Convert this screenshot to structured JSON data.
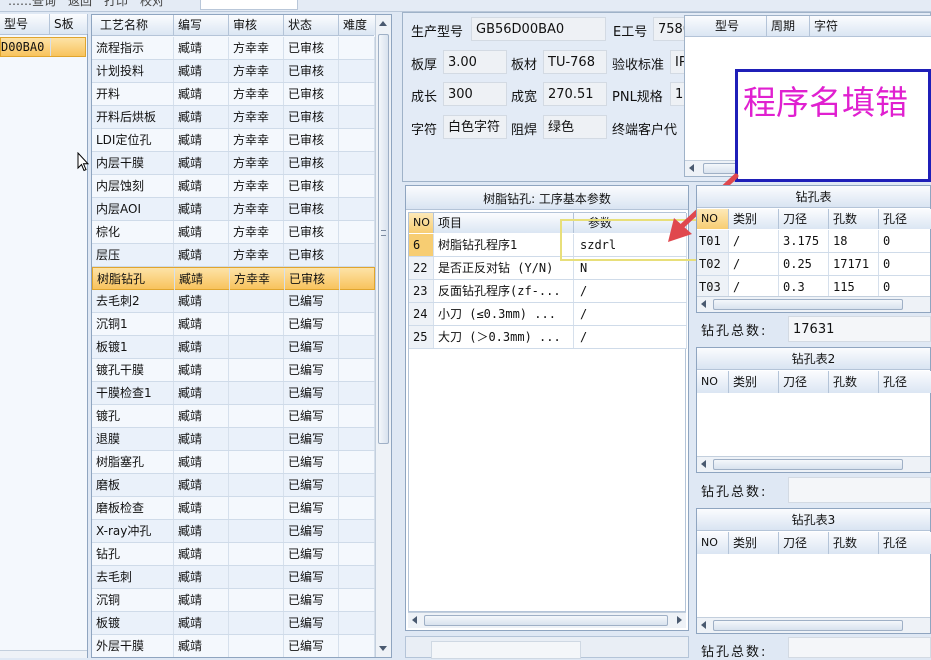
{
  "top_strip": {
    "text": "……查询　返回　打印　校对"
  },
  "left_grid": {
    "columns": [
      "型号",
      "S板"
    ],
    "rows": [
      {
        "model": "D00BA0",
        "s": ""
      }
    ]
  },
  "process_grid": {
    "columns": [
      "工艺名称",
      "编写",
      "审核",
      "状态",
      "难度"
    ],
    "rows": [
      {
        "name": "流程指示",
        "writer": "臧靖",
        "reviewer": "方幸幸",
        "status": "已审核"
      },
      {
        "name": "计划投料",
        "writer": "臧靖",
        "reviewer": "方幸幸",
        "status": "已审核"
      },
      {
        "name": "开料",
        "writer": "臧靖",
        "reviewer": "方幸幸",
        "status": "已审核"
      },
      {
        "name": "开料后烘板",
        "writer": "臧靖",
        "reviewer": "方幸幸",
        "status": "已审核"
      },
      {
        "name": "LDI定位孔",
        "writer": "臧靖",
        "reviewer": "方幸幸",
        "status": "已审核"
      },
      {
        "name": "内层干膜",
        "writer": "臧靖",
        "reviewer": "方幸幸",
        "status": "已审核"
      },
      {
        "name": "内层蚀刻",
        "writer": "臧靖",
        "reviewer": "方幸幸",
        "status": "已审核"
      },
      {
        "name": "内层AOI",
        "writer": "臧靖",
        "reviewer": "方幸幸",
        "status": "已审核"
      },
      {
        "name": "棕化",
        "writer": "臧靖",
        "reviewer": "方幸幸",
        "status": "已审核"
      },
      {
        "name": "层压",
        "writer": "臧靖",
        "reviewer": "方幸幸",
        "status": "已审核"
      },
      {
        "name": "树脂钻孔",
        "writer": "臧靖",
        "reviewer": "方幸幸",
        "status": "已审核",
        "selected": true
      },
      {
        "name": "去毛刺2",
        "writer": "臧靖",
        "reviewer": "",
        "status": "已编写"
      },
      {
        "name": "沉铜1",
        "writer": "臧靖",
        "reviewer": "",
        "status": "已编写"
      },
      {
        "name": "板镀1",
        "writer": "臧靖",
        "reviewer": "",
        "status": "已编写"
      },
      {
        "name": "镀孔干膜",
        "writer": "臧靖",
        "reviewer": "",
        "status": "已编写"
      },
      {
        "name": "干膜检查1",
        "writer": "臧靖",
        "reviewer": "",
        "status": "已编写"
      },
      {
        "name": "镀孔",
        "writer": "臧靖",
        "reviewer": "",
        "status": "已编写"
      },
      {
        "name": "退膜",
        "writer": "臧靖",
        "reviewer": "",
        "status": "已编写"
      },
      {
        "name": "树脂塞孔",
        "writer": "臧靖",
        "reviewer": "",
        "status": "已编写"
      },
      {
        "name": "磨板",
        "writer": "臧靖",
        "reviewer": "",
        "status": "已编写"
      },
      {
        "name": "磨板检查",
        "writer": "臧靖",
        "reviewer": "",
        "status": "已编写"
      },
      {
        "name": "X-ray冲孔",
        "writer": "臧靖",
        "reviewer": "",
        "status": "已编写"
      },
      {
        "name": "钻孔",
        "writer": "臧靖",
        "reviewer": "",
        "status": "已编写"
      },
      {
        "name": "去毛刺",
        "writer": "臧靖",
        "reviewer": "",
        "status": "已编写"
      },
      {
        "name": "沉铜",
        "writer": "臧靖",
        "reviewer": "",
        "status": "已编写"
      },
      {
        "name": "板镀",
        "writer": "臧靖",
        "reviewer": "",
        "status": "已编写"
      },
      {
        "name": "外层干膜",
        "writer": "臧靖",
        "reviewer": "",
        "status": "已编写"
      }
    ]
  },
  "info": {
    "model_label": "生产型号",
    "model_value": "GB56D00BA0",
    "eno_label": "E工号",
    "eno_value": "758075",
    "thickness_label": "板厚",
    "thickness_value": "3.00",
    "material_label": "板材",
    "material_value": "TU-768",
    "standard_label": "验收标准",
    "standard_value": "IP",
    "length_label": "成长",
    "length_value": "300",
    "width_label": "成宽",
    "width_value": "270.51",
    "pnl_label": "PNL规格",
    "pnl_value": "1",
    "char_label": "字符",
    "char_value": "白色字符",
    "mask_label": "阻焊",
    "mask_value": "绿色",
    "customer_label": "终端客户代"
  },
  "mini_grid": {
    "columns": [
      "型号",
      "周期",
      "字符"
    ]
  },
  "annotation": {
    "text": "程序名填错"
  },
  "params": {
    "title": "树脂钻孔: 工序基本参数",
    "columns": [
      "NO",
      "项目",
      "参数"
    ],
    "rows": [
      {
        "no": "6",
        "item": "树脂钻孔程序1",
        "value": "szdrl"
      },
      {
        "no": "22",
        "item": "是否正反对钻 (Y/N)",
        "value": "N"
      },
      {
        "no": "23",
        "item": "反面钻孔程序(zf-...",
        "value": "/"
      },
      {
        "no": "24",
        "item": "小刀 (≤0.3mm) ...",
        "value": "/"
      },
      {
        "no": "25",
        "item": "大刀 (＞0.3mm) ...",
        "value": "/"
      }
    ]
  },
  "drill1": {
    "title": "钻孔表",
    "columns": [
      "NO",
      "类别",
      "刀径",
      "孔数",
      "孔径"
    ],
    "rows": [
      {
        "no": "T01",
        "cat": "/",
        "dia": "3.175",
        "count": "18",
        "hole": "0"
      },
      {
        "no": "T02",
        "cat": "/",
        "dia": "0.25",
        "count": "17171",
        "hole": "0"
      },
      {
        "no": "T03",
        "cat": "/",
        "dia": "0.3",
        "count": "115",
        "hole": "0"
      }
    ],
    "total_label": "钻孔总数:",
    "total_value": "17631"
  },
  "drill2": {
    "title": "钻孔表2",
    "columns": [
      "NO",
      "类别",
      "刀径",
      "孔数",
      "孔径"
    ],
    "total_label": "钻孔总数:",
    "total_value": ""
  },
  "drill3": {
    "title": "钻孔表3",
    "columns": [
      "NO",
      "类别",
      "刀径",
      "孔数",
      "孔径"
    ],
    "total_label": "钻孔总数:",
    "total_value": ""
  },
  "colors": {
    "selected_row": "#f8c35d",
    "annotation_text": "#e020d0",
    "annotation_border": "#1f1fb8",
    "highlight_box": "#e8df7a",
    "arrow": "#e0484e"
  }
}
